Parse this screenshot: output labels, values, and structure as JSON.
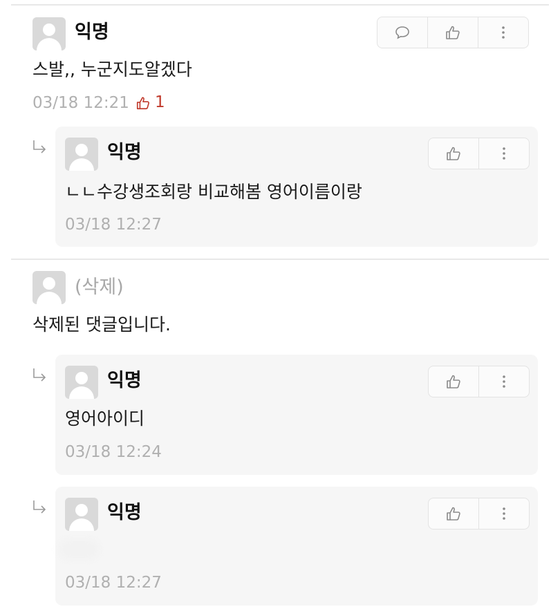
{
  "comments": [
    {
      "author": "익명",
      "text": "스발,, 누군지도알겠다",
      "time": "03/18 12:21",
      "likes": "1",
      "replies": [
        {
          "author": "익명",
          "text": "ㄴㄴ수강생조회랑 비교해봄 영어이름이랑",
          "time": "03/18 12:27"
        }
      ]
    },
    {
      "author": "(삭제)",
      "text": "삭제된 댓글입니다.",
      "replies": [
        {
          "author": "익명",
          "text": "영어아이디",
          "time": "03/18 12:24"
        },
        {
          "author": "익명",
          "text": "",
          "time": "03/18 12:27"
        }
      ]
    }
  ],
  "icons": {
    "reply": "speech-bubble-icon",
    "like": "thumbs-up-icon",
    "more": "vertical-dots-icon",
    "reply_arrow": "reply-arrow-icon"
  },
  "colors": {
    "like_count": "#c0392b",
    "muted": "#b0b0b0",
    "reply_bg": "#f6f6f6"
  }
}
